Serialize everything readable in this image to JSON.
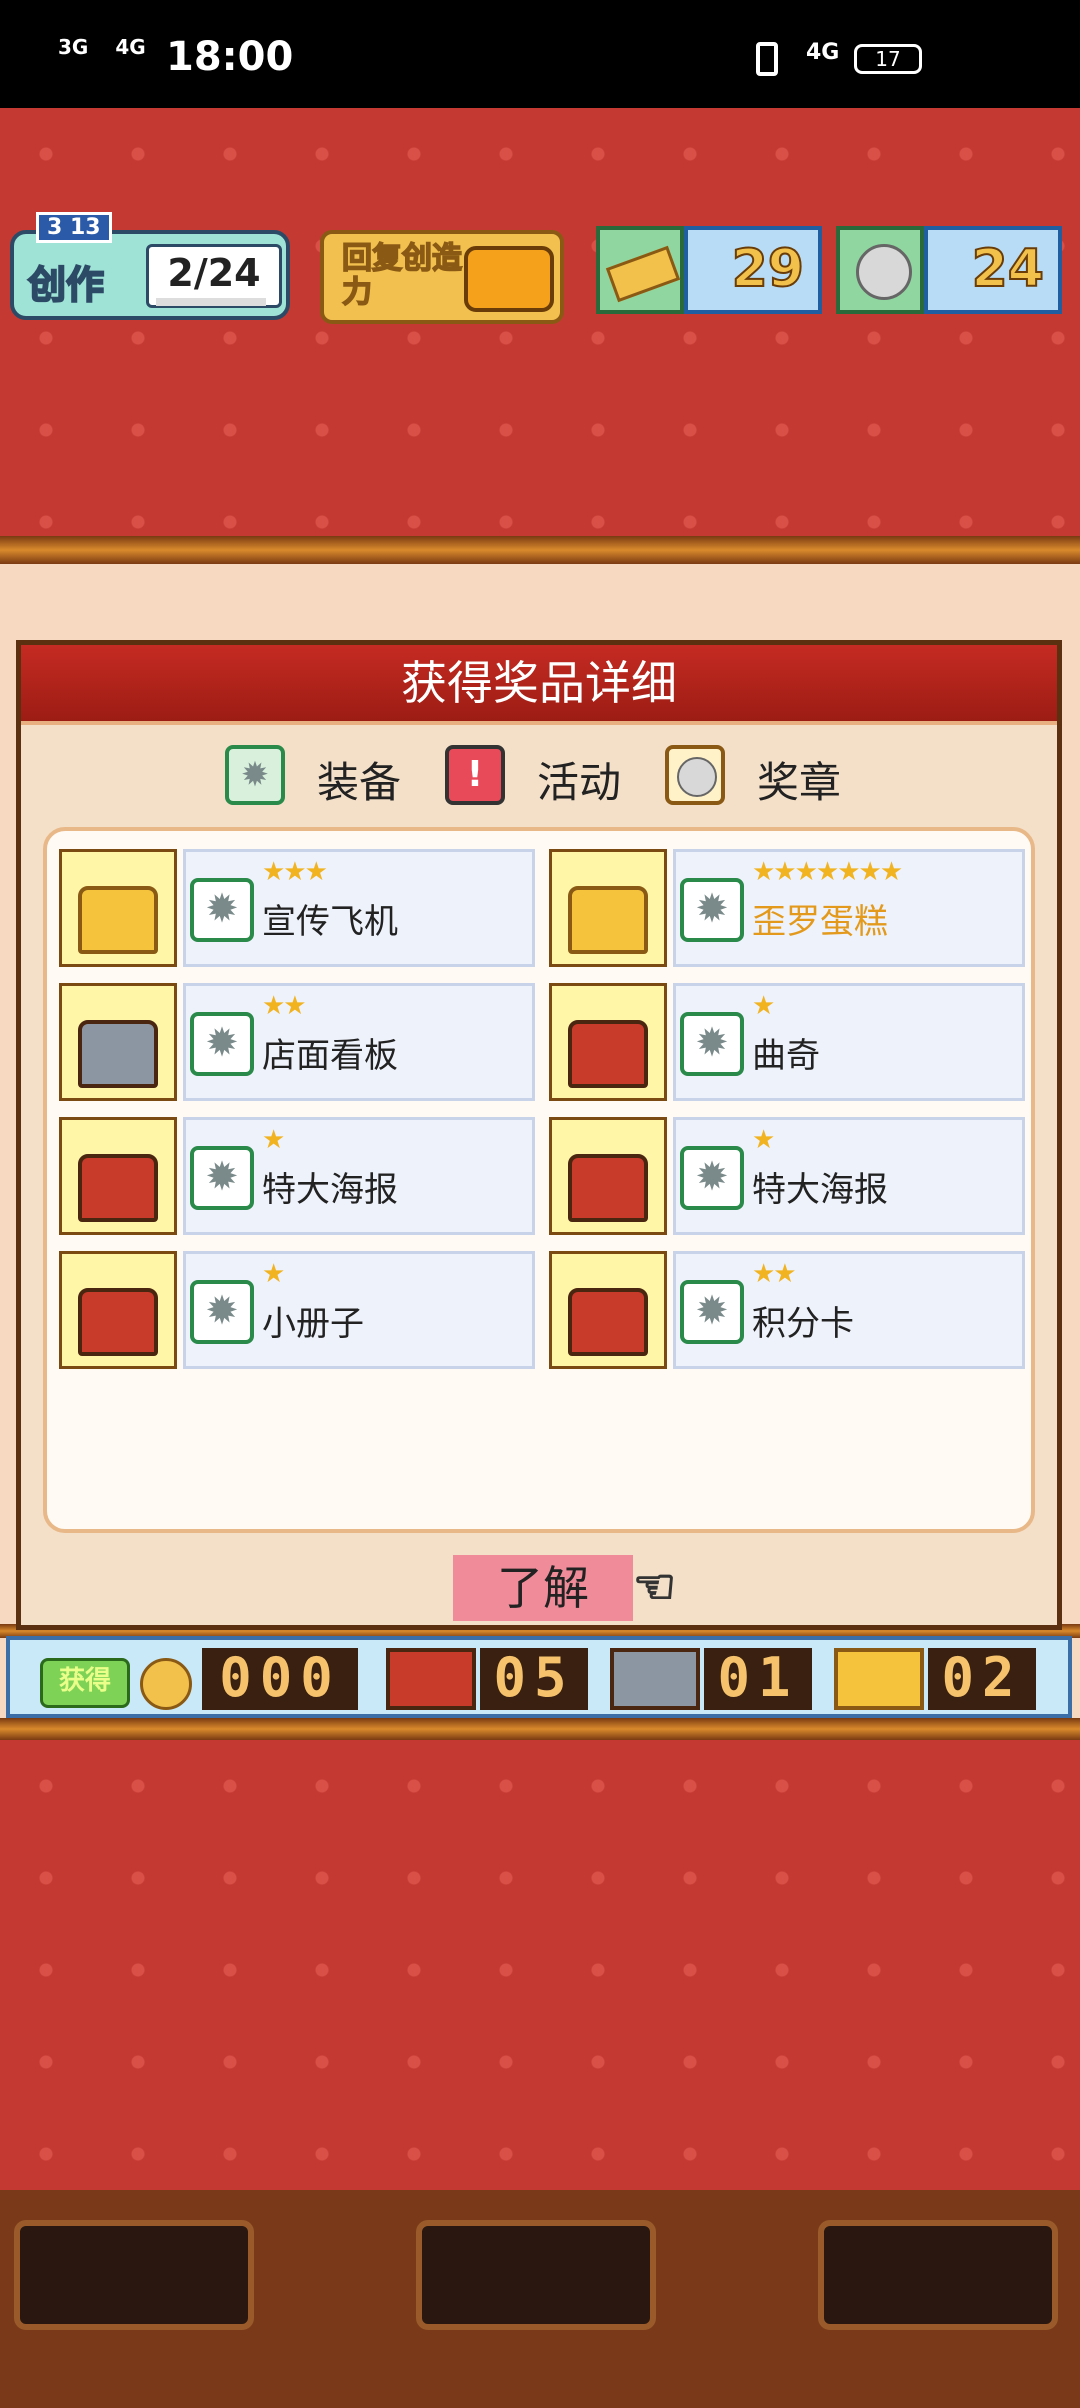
{
  "status_bar": {
    "signal_1": "3G",
    "signal_2": "4G",
    "time": "18:00",
    "network": "4G",
    "battery": "17"
  },
  "hud": {
    "create_level": "3 13",
    "create_label": "创作",
    "create_count": "2/24",
    "restore_label": "回复创造力",
    "gold_count": "29",
    "medal_count": "24"
  },
  "modal": {
    "title": "获得奖品详细",
    "legend": [
      {
        "icon": "gear-icon",
        "label": "装备"
      },
      {
        "icon": "exclamation-icon",
        "label": "活动"
      },
      {
        "icon": "medal-icon",
        "label": "奖章"
      }
    ],
    "items": [
      {
        "chest": "gold",
        "stars": "★★★",
        "name": "宣传飞机",
        "highlight": false
      },
      {
        "chest": "gold",
        "stars": "★★★★★★★",
        "name": "歪罗蛋糕",
        "highlight": true
      },
      {
        "chest": "silver",
        "stars": "★★",
        "name": "店面看板",
        "highlight": false
      },
      {
        "chest": "red",
        "stars": "★",
        "name": "曲奇",
        "highlight": false
      },
      {
        "chest": "red",
        "stars": "★",
        "name": "特大海报",
        "highlight": false
      },
      {
        "chest": "red",
        "stars": "★",
        "name": "特大海报",
        "highlight": false
      },
      {
        "chest": "red",
        "stars": "★",
        "name": "小册子",
        "highlight": false
      },
      {
        "chest": "red",
        "stars": "★★",
        "name": "积分卡",
        "highlight": false
      }
    ],
    "ok_label": "了解"
  },
  "counter": {
    "get_label": "获得",
    "coins": "000",
    "red_chests": "05",
    "silver_chests": "01",
    "gold_chests": "02"
  },
  "colors": {
    "gold_text": "#e39a1c",
    "wall": "#c43a33"
  }
}
